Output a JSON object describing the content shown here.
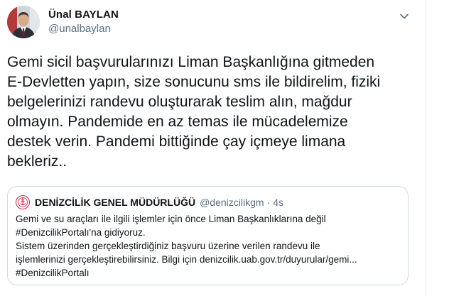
{
  "tweet": {
    "author": {
      "name": "Ünal BAYLAN",
      "handle": "@unalbaylan"
    },
    "text_lines": [
      "Gemi sicil başvurularınızı Liman Başkanlığına gitmeden",
      "E-Devletten yapın, size sonucunu sms ile bildirelim, fiziki",
      "belgelerinizi randevu oluşturarak teslim alın, mağdur",
      "olmayın. Pandemide en az temas ile mücadelemize",
      "destek verin. Pandemi bittiğinde çay içmeye limana",
      "bekleriz.."
    ],
    "more_icon": "chevron-down-icon"
  },
  "quoted_tweet": {
    "author": {
      "name": "DENİZCİLİK GENEL MÜDÜRLÜĞÜ",
      "handle": "@denizcilikgm",
      "separator": "·",
      "time": "4s"
    },
    "text_lines": [
      "Gemi ve su araçları ile ilgili işlemler için önce Liman Başkanlıklarına değil",
      "#DenizcilikPortalı'na gidiyoruz.",
      "Sistem üzerinden gerçekleştirdiğiniz başvuru üzerine verilen randevu ile",
      "işlemlerinizi gerçekleştirebilirsiniz. Bilgi için denizcilik.uab.gov.tr/duyurular/gemi...",
      "#DenizcilikPortalı"
    ]
  },
  "colors": {
    "text_primary": "#0f1419",
    "text_secondary": "#5b7083",
    "border": "#cfd9de",
    "logo_red": "#c8102e"
  }
}
